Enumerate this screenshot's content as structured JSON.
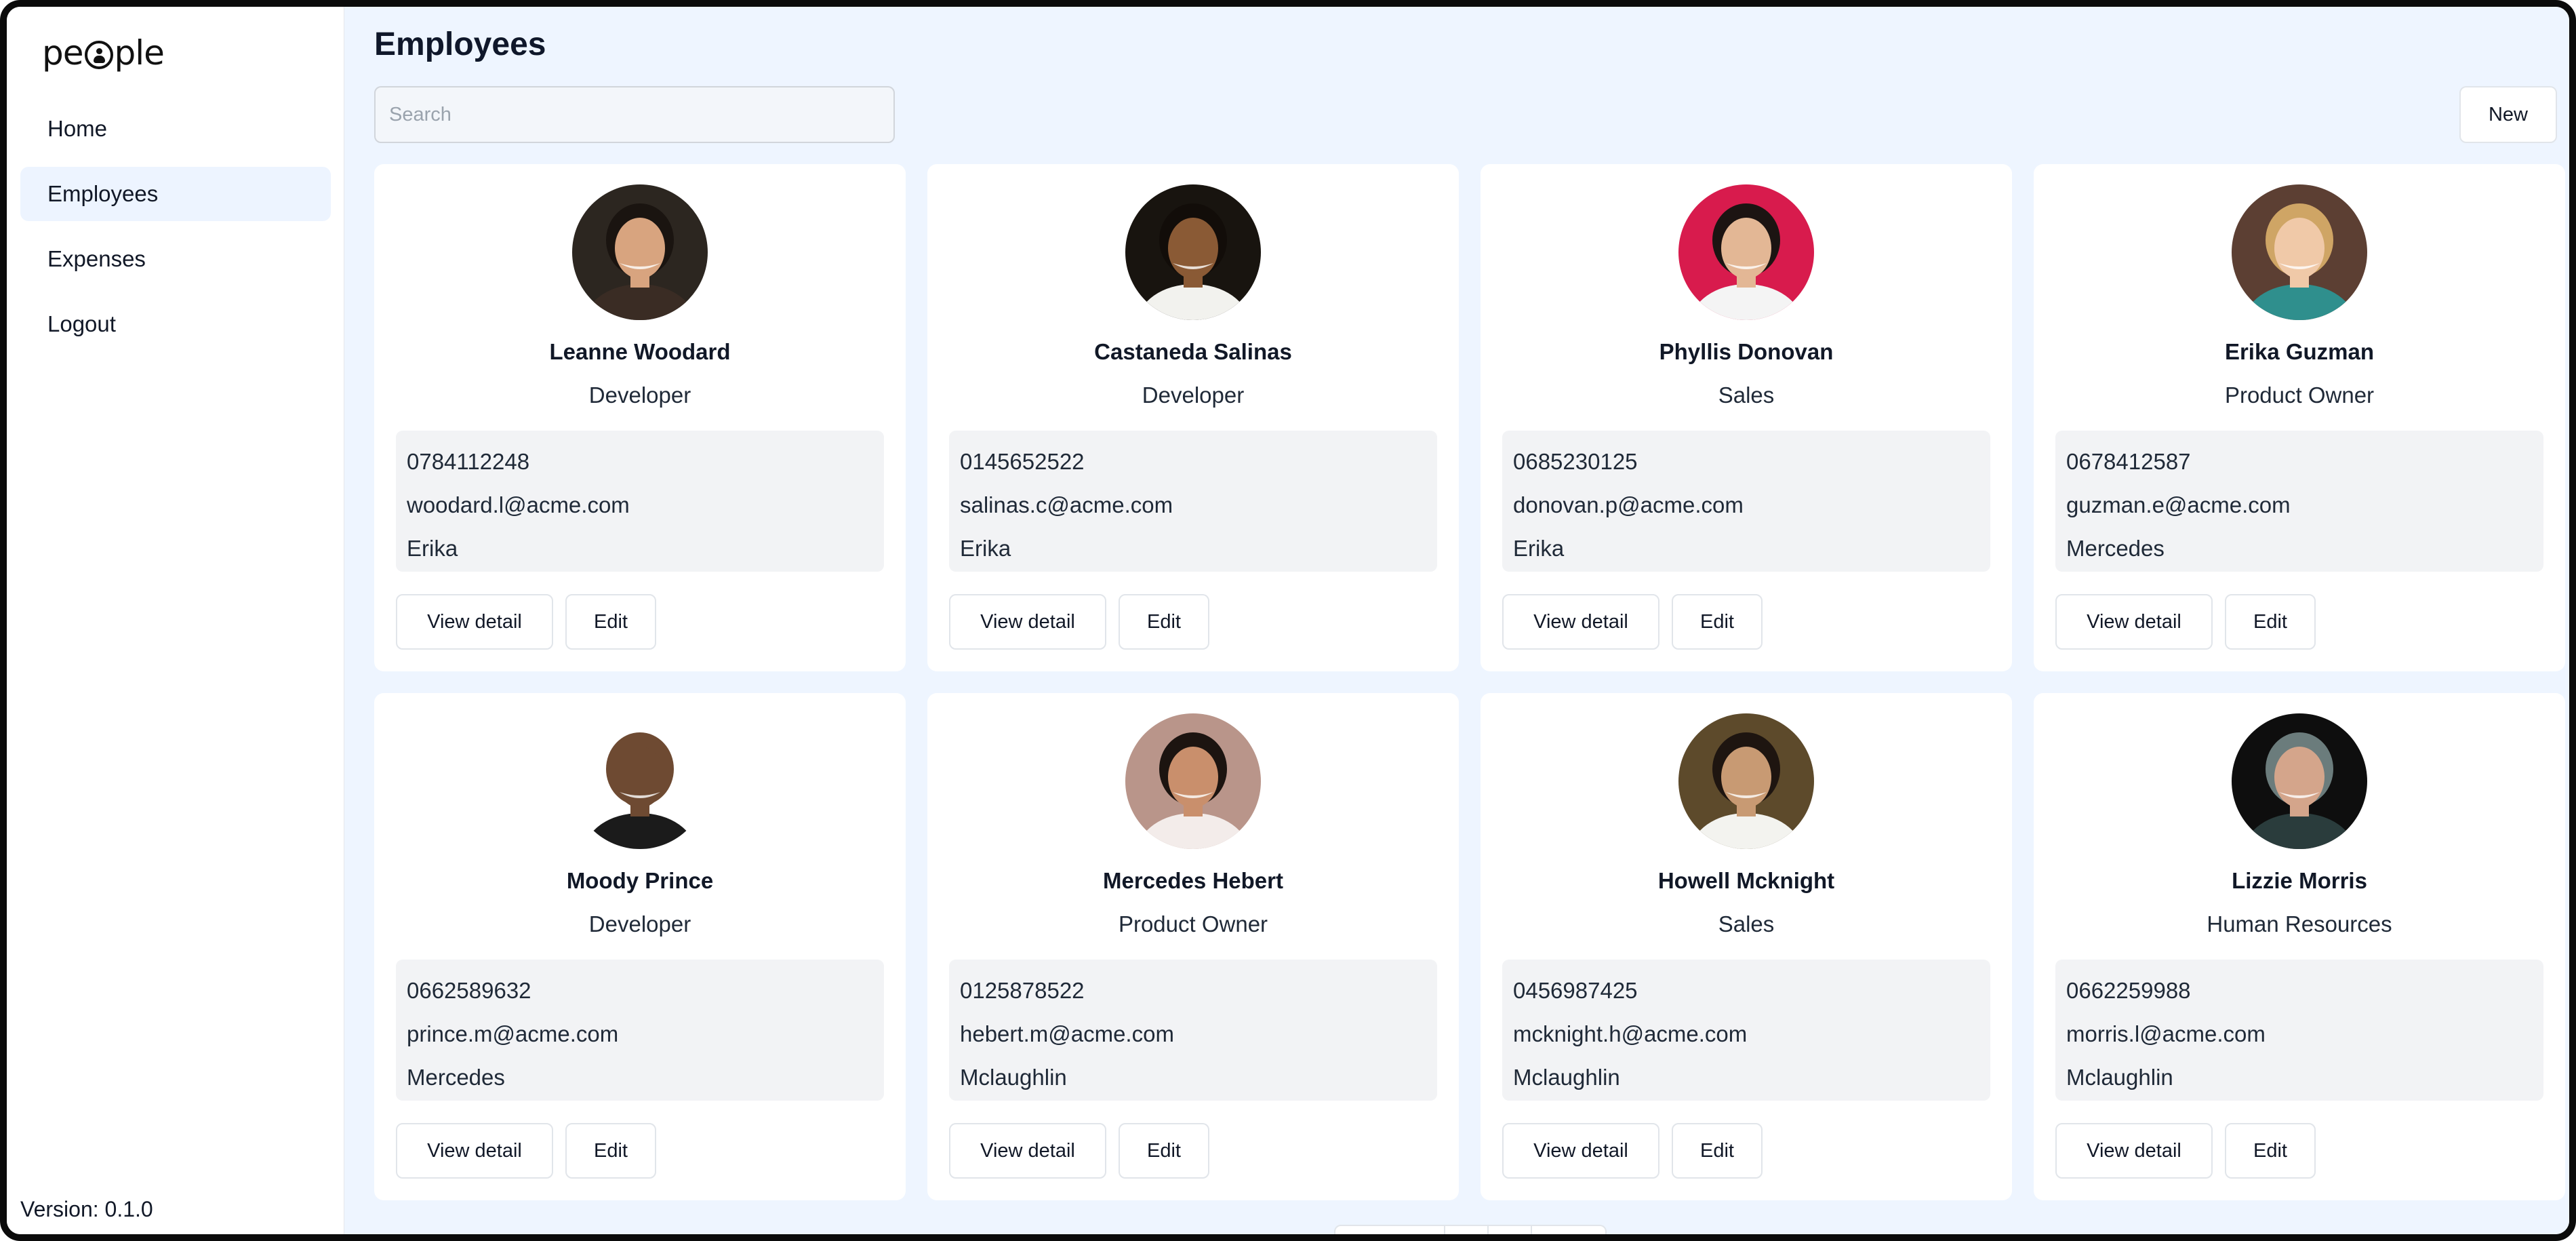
{
  "app": {
    "logo": {
      "before": "pe",
      "after": "ple"
    }
  },
  "sidebar": {
    "items": [
      {
        "label": "Home",
        "active": false
      },
      {
        "label": "Employees",
        "active": true
      },
      {
        "label": "Expenses",
        "active": false
      },
      {
        "label": "Logout",
        "active": false
      }
    ],
    "version": "Version: 0.1.0"
  },
  "header": {
    "title": "Employees",
    "search_placeholder": "Search",
    "new_label": "New"
  },
  "cards": {
    "view_label": "View detail",
    "edit_label": "Edit",
    "employees": [
      {
        "name": "Leanne Woodard",
        "role": "Developer",
        "phone": "0784112248",
        "email": "woodard.l@acme.com",
        "manager": "Erika",
        "avatar": {
          "bg": "#2c2620",
          "skin": "#d8a47f",
          "hair": "#1a1410",
          "shirt": "#3a2c24"
        }
      },
      {
        "name": "Castaneda Salinas",
        "role": "Developer",
        "phone": "0145652522",
        "email": "salinas.c@acme.com",
        "manager": "Erika",
        "avatar": {
          "bg": "#18140f",
          "skin": "#8a5a35",
          "hair": "#120d09",
          "shirt": "#f2f2ee"
        }
      },
      {
        "name": "Phyllis Donovan",
        "role": "Sales",
        "phone": "0685230125",
        "email": "donovan.p@acme.com",
        "manager": "Erika",
        "avatar": {
          "bg": "#d81b4d",
          "skin": "#e3b795",
          "hair": "#1c1412",
          "shirt": "#f4f4f4"
        }
      },
      {
        "name": "Erika Guzman",
        "role": "Product Owner",
        "phone": "0678412587",
        "email": "guzman.e@acme.com",
        "manager": "Mercedes",
        "avatar": {
          "bg": "#5c3f33",
          "skin": "#f0c9a8",
          "hair": "#cfa565",
          "shirt": "#2f8f8d"
        }
      },
      {
        "name": "Moody Prince",
        "role": "Developer",
        "phone": "0662589632",
        "email": "prince.m@acme.com",
        "manager": "Mercedes",
        "avatar": {
          "bg": "#ffffff",
          "skin": "#6e4a32",
          "hair": "#6e4a32",
          "shirt": "#1b1b1b"
        }
      },
      {
        "name": "Mercedes Hebert",
        "role": "Product Owner",
        "phone": "0125878522",
        "email": "hebert.m@acme.com",
        "manager": "Mclaughlin",
        "avatar": {
          "bg": "#b9958a",
          "skin": "#c98f6c",
          "hair": "#1c1410",
          "shirt": "#f3ecea"
        }
      },
      {
        "name": "Howell Mcknight",
        "role": "Sales",
        "phone": "0456987425",
        "email": "mcknight.h@acme.com",
        "manager": "Mclaughlin",
        "avatar": {
          "bg": "#5d4a2b",
          "skin": "#c89a73",
          "hair": "#1e1510",
          "shirt": "#f3f3ef"
        }
      },
      {
        "name": "Lizzie Morris",
        "role": "Human Resources",
        "phone": "0662259988",
        "email": "morris.l@acme.com",
        "manager": "Mclaughlin",
        "avatar": {
          "bg": "#0e0e0e",
          "skin": "#d4a58b",
          "hair": "#6b7c7c",
          "shirt": "#2a3c3c"
        }
      }
    ]
  }
}
